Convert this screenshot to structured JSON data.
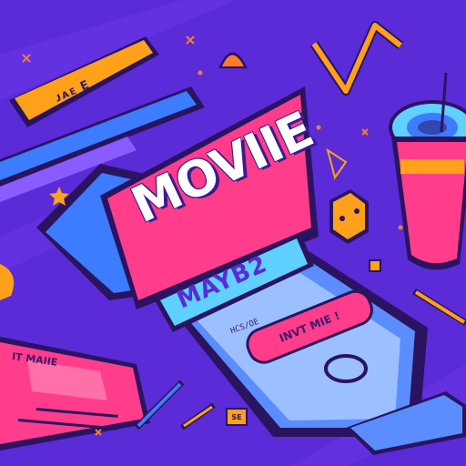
{
  "flag": {
    "label": "ᴊᴀᴇ E"
  },
  "poster": {
    "title": "MOVIIE",
    "subtitle": "MAYB2"
  },
  "phone": {
    "small_text": "HCS/OE",
    "button_label": "INVT MIE !"
  },
  "ticket": {
    "label": "IT MAIIE"
  },
  "badge": {
    "label": "SE"
  },
  "colors": {
    "background": "#5a2bd6",
    "pink": "#ff3d8b",
    "blue": "#3d7bff",
    "orange": "#ffa11a",
    "dark_outline": "#2a1460"
  }
}
